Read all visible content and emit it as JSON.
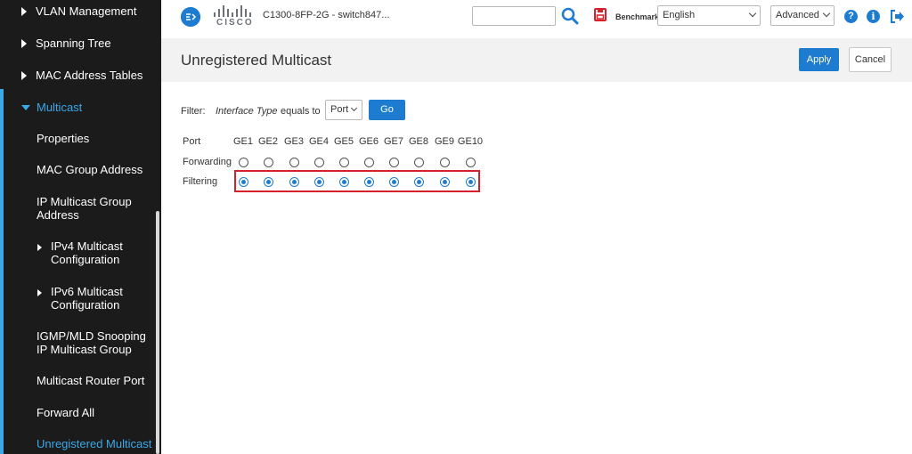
{
  "sidebar": {
    "top_items": [
      "VLAN Management",
      "Spanning Tree",
      "MAC Address Tables"
    ],
    "open_section": "Multicast",
    "sub_items": [
      "Properties",
      "MAC Group Address",
      "IP Multicast Group Address"
    ],
    "expandable_items": [
      "IPv4 Multicast Configuration",
      "IPv6 Multicast Configuration"
    ],
    "more_items": [
      "IGMP/MLD Snooping IP Multicast Group",
      "Multicast Router Port",
      "Forward All"
    ],
    "active_item": "Unregistered Multicast"
  },
  "header": {
    "menu_icon": "menu-toggle-icon",
    "logo_text": "CISCO",
    "device_name": "C1300-8FP-2G - switch847...",
    "search_value": "",
    "save_icon": "save-icon",
    "benchmark_label": "Benchmark",
    "language": "English",
    "mode": "Advanced",
    "help_icon": "?",
    "info_icon": "i"
  },
  "page": {
    "title": "Unregistered Multicast",
    "apply_label": "Apply",
    "cancel_label": "Cancel"
  },
  "filter": {
    "label": "Filter:",
    "field": "Interface Type",
    "operator": "equals to",
    "value": "Port",
    "go_label": "Go"
  },
  "grid": {
    "port_label": "Port",
    "forwarding_label": "Forwarding",
    "filtering_label": "Filtering",
    "ports": [
      "GE1",
      "GE2",
      "GE3",
      "GE4",
      "GE5",
      "GE6",
      "GE7",
      "GE8",
      "GE9",
      "GE10"
    ],
    "selected_mode": "Filtering"
  },
  "colors": {
    "accent": "#1d7ccf",
    "sidebar_active": "#3ba8e8",
    "sidebar_bg": "#1b1b1b",
    "highlight": "#d6202a"
  }
}
